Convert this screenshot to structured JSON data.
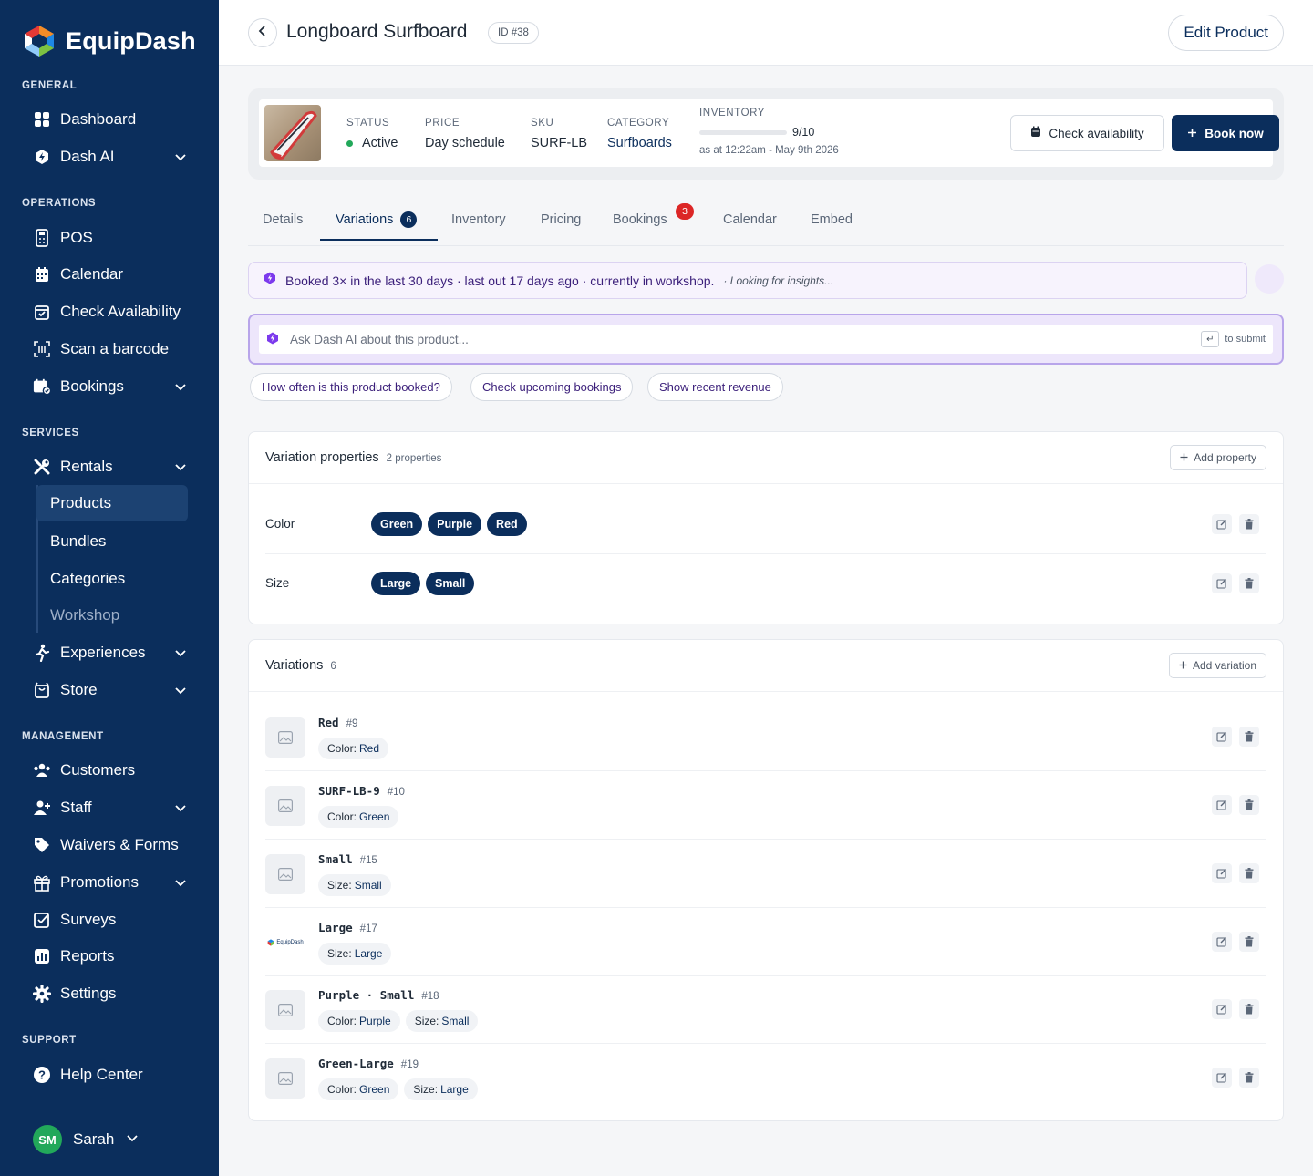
{
  "brand": {
    "name": "EquipDash"
  },
  "sidebar": {
    "sections": {
      "general": "GENERAL",
      "operations": "OPERATIONS",
      "services": "SERVICES",
      "management": "MANAGEMENT",
      "support": "SUPPORT"
    },
    "items": {
      "dashboard": "Dashboard",
      "dash_ai": "Dash AI",
      "pos": "POS",
      "calendar": "Calendar",
      "check_availability": "Check Availability",
      "scan_barcode": "Scan a barcode",
      "bookings": "Bookings",
      "rentals": "Rentals",
      "experiences": "Experiences",
      "store": "Store",
      "customers": "Customers",
      "staff": "Staff",
      "waivers": "Waivers & Forms",
      "promotions": "Promotions",
      "surveys": "Surveys",
      "reports": "Reports",
      "settings": "Settings",
      "help_center": "Help Center"
    },
    "rentals_sub": {
      "products": "Products",
      "bundles": "Bundles",
      "categories": "Categories",
      "workshop": "Workshop"
    },
    "user": {
      "initials": "SM",
      "name": "Sarah"
    }
  },
  "header": {
    "title": "Longboard Surfboard",
    "id_badge": "ID #38",
    "edit_label": "Edit Product"
  },
  "summary": {
    "status_label": "STATUS",
    "status_value": "Active",
    "price_label": "PRICE",
    "price_value": "Day schedule",
    "sku_label": "SKU",
    "sku_value": "SURF-LB",
    "category_label": "CATEGORY",
    "category_value": "Surfboards",
    "inventory_label": "INVENTORY",
    "inventory_available": 9,
    "inventory_total": 10,
    "inventory_text": "9/10",
    "inventory_asat": "as at 12:22am - May 9th 2026",
    "check_label": "Check availability",
    "book_label": "Book now"
  },
  "tabs": {
    "details": "Details",
    "variations": "Variations",
    "variations_count": "6",
    "inventory": "Inventory",
    "pricing": "Pricing",
    "bookings": "Bookings",
    "bookings_alert": "3",
    "calendar": "Calendar",
    "embed": "Embed"
  },
  "insight": {
    "text": "Booked 3× in the last 30 days · last out 17 days ago · currently in workshop.",
    "muted": "· Looking for insights..."
  },
  "ask": {
    "value": "",
    "placeholder": "Ask Dash AI about this product...",
    "submit_key": "↵",
    "submit_hint": "to submit",
    "chips": [
      "How often is this product booked?",
      "Check upcoming bookings",
      "Show recent revenue"
    ]
  },
  "properties": {
    "title": "Variation properties",
    "count_label": "2 properties",
    "add_label": "Add property",
    "rows": [
      {
        "name": "Color",
        "values": [
          "Green",
          "Purple",
          "Red"
        ]
      },
      {
        "name": "Size",
        "values": [
          "Large",
          "Small"
        ]
      }
    ]
  },
  "variations": {
    "title": "Variations",
    "count": "6",
    "add_label": "Add variation",
    "logo_text": "EquipDash",
    "rows": [
      {
        "name": "Red",
        "id": "#9",
        "tags": [
          {
            "k": "Color:",
            "v": "Red"
          }
        ]
      },
      {
        "name": "SURF-LB-9",
        "id": "#10",
        "tags": [
          {
            "k": "Color:",
            "v": "Green"
          }
        ]
      },
      {
        "name": "Small",
        "id": "#15",
        "tags": [
          {
            "k": "Size:",
            "v": "Small"
          }
        ]
      },
      {
        "name": "Large",
        "id": "#17",
        "tags": [
          {
            "k": "Size:",
            "v": "Large"
          }
        ]
      },
      {
        "name": "Purple · Small",
        "id": "#18",
        "tags": [
          {
            "k": "Color:",
            "v": "Purple"
          },
          {
            "k": "Size:",
            "v": "Small"
          }
        ]
      },
      {
        "name": "Green-Large",
        "id": "#19",
        "tags": [
          {
            "k": "Color:",
            "v": "Green"
          },
          {
            "k": "Size:",
            "v": "Large"
          }
        ]
      }
    ]
  },
  "colors": {
    "sidebar": "#0b2e5c",
    "primary": "#0b2e5c",
    "active_green": "#22a85a",
    "alert_red": "#dc2626",
    "ai_purple": "#7c3aed"
  }
}
